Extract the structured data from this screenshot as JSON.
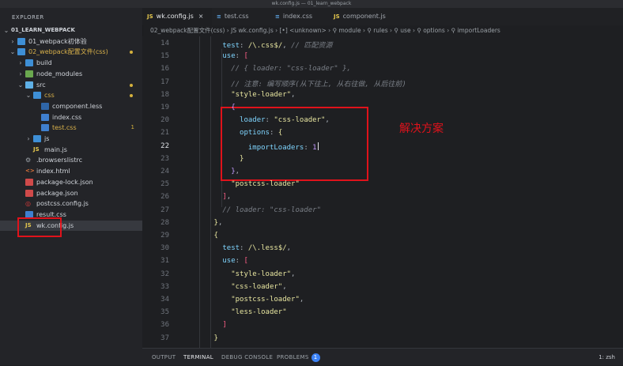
{
  "window": {
    "title": "wk.config.js — 01_learn_webpack"
  },
  "sidebar": {
    "header": "EXPLORER",
    "rows": [
      {
        "chev": "⌄",
        "icon": "",
        "label": "01_LEARN_WEBPACK",
        "indent": 6,
        "bold": true
      },
      {
        "chev": "›",
        "icon": "folder-icon",
        "label": "01_webpack初体验",
        "indent": 14
      },
      {
        "chev": "⌄",
        "icon": "folder-icon",
        "label": "02_webpack配置文件(css)",
        "indent": 14,
        "yellow": true,
        "dot": true
      },
      {
        "chev": "›",
        "icon": "folder-build-icon",
        "label": "build",
        "indent": 24
      },
      {
        "chev": "›",
        "icon": "folder-node-icon",
        "label": "node_modules",
        "indent": 24
      },
      {
        "chev": "⌄",
        "icon": "folder-src-icon",
        "label": "src",
        "indent": 24,
        "dot": true
      },
      {
        "chev": "⌄",
        "icon": "folder-css-icon",
        "label": "css",
        "indent": 34,
        "yellow": true,
        "dot": true
      },
      {
        "chev": "",
        "icon": "less-file-icon",
        "label": "component.less",
        "indent": 44
      },
      {
        "chev": "",
        "icon": "css-file-icon",
        "label": "index.css",
        "indent": 44
      },
      {
        "chev": "",
        "icon": "css-file-icon",
        "label": "test.css",
        "indent": 44,
        "yellow": true,
        "num": "1"
      },
      {
        "chev": "›",
        "icon": "folder-js-icon",
        "label": "js",
        "indent": 34
      },
      {
        "chev": "",
        "icon": "js-file-icon",
        "label": "main.js",
        "indent": 34
      },
      {
        "chev": "",
        "icon": "gear-file-icon",
        "label": ".browserslistrc",
        "indent": 24
      },
      {
        "chev": "",
        "icon": "html-file-icon",
        "label": "index.html",
        "indent": 24
      },
      {
        "chev": "",
        "icon": "json-file-icon",
        "label": "package-lock.json",
        "indent": 24
      },
      {
        "chev": "",
        "icon": "json-file-icon",
        "label": "package.json",
        "indent": 24
      },
      {
        "chev": "",
        "icon": "postcss-file-icon",
        "label": "postcss.config.js",
        "indent": 24
      },
      {
        "chev": "",
        "icon": "css-file-icon",
        "label": "result.css",
        "indent": 24
      },
      {
        "chev": "",
        "icon": "js-file-icon",
        "label": "wk.config.js",
        "indent": 24,
        "selected": true
      }
    ]
  },
  "tabs": [
    {
      "icon": "JS",
      "label": "wk.config.js",
      "active": true,
      "close": "×"
    },
    {
      "icon": "≡",
      "label": "test.css"
    },
    {
      "icon": "≡",
      "label": "index.css"
    },
    {
      "icon": "JS",
      "label": "component.js"
    }
  ],
  "breadcrumb": "02_webpack配置文件(css)  ›  JS wk.config.js  ›  [•] <unknown>  ›  ⚲ module  ›  ⚲ rules  ›  ⚲ use  ›  ⚲ options  ›  ⚲ importLoaders",
  "editor": {
    "lines": [
      {
        "n": "14",
        "html": "        <span class='prop'>test</span><span class='p'>:</span> <span class='s'>/\\.css$/</span><span class='p'>,</span> <span class='c'>// 匹配资源</span>"
      },
      {
        "n": "15",
        "html": "        <span class='prop'>use</span><span class='p'>:</span> <span class='k'>[</span>"
      },
      {
        "n": "16",
        "html": "          <span class='c'>// { loader: \"css-loader\" },</span>"
      },
      {
        "n": "17",
        "html": "          <span class='c'>// 注意: 编写顺序(从下往上, 从右往做, 从后往前)</span>"
      },
      {
        "n": "18",
        "html": "          <span class='s'>\"style-loader\"</span><span class='p'>,</span>"
      },
      {
        "n": "19",
        "html": "          <span class='n'>{</span>"
      },
      {
        "n": "20",
        "html": "            <span class='prop'>loader</span><span class='p'>:</span> <span class='s'>\"css-loader\"</span><span class='p'>,</span>"
      },
      {
        "n": "21",
        "html": "            <span class='prop'>options</span><span class='p'>:</span> <span class='s'>{</span>"
      },
      {
        "n": "22",
        "html": "              <span class='prop'>importLoaders</span><span class='p'>:</span> <span class='n'>1</span><span class='cursor'></span>",
        "cur": true
      },
      {
        "n": "23",
        "html": "            <span class='s'>}</span>"
      },
      {
        "n": "24",
        "html": "          <span class='n'>}</span><span class='p'>,</span>"
      },
      {
        "n": "25",
        "html": "          <span class='s'>\"postcss-loader\"</span>"
      },
      {
        "n": "26",
        "html": "        <span class='k'>]</span><span class='p'>,</span>"
      },
      {
        "n": "27",
        "html": "        <span class='c'>// loader: \"css-loader\"</span>"
      },
      {
        "n": "28",
        "html": "      <span class='s'>}</span><span class='p'>,</span>"
      },
      {
        "n": "29",
        "html": "      <span class='s'>{</span>"
      },
      {
        "n": "30",
        "html": "        <span class='prop'>test</span><span class='p'>:</span> <span class='s'>/\\.less$/</span><span class='p'>,</span>"
      },
      {
        "n": "31",
        "html": "        <span class='prop'>use</span><span class='p'>:</span> <span class='k'>[</span>"
      },
      {
        "n": "32",
        "html": "          <span class='s'>\"style-loader\"</span><span class='p'>,</span>"
      },
      {
        "n": "33",
        "html": "          <span class='s'>\"css-loader\"</span><span class='p'>,</span>"
      },
      {
        "n": "34",
        "html": "          <span class='s'>\"postcss-loader\"</span><span class='p'>,</span>"
      },
      {
        "n": "35",
        "html": "          <span class='s'>\"less-loader\"</span>"
      },
      {
        "n": "36",
        "html": "        <span class='k'>]</span>"
      },
      {
        "n": "37",
        "html": "      <span class='s'>}</span>"
      }
    ],
    "annotation": "解决方案"
  },
  "panel": {
    "tabs": [
      "OUTPUT",
      "TERMINAL",
      "DEBUG CONSOLE",
      "PROBLEMS"
    ],
    "active": "TERMINAL",
    "problems_count": "1",
    "shell": "1: zsh"
  },
  "colors": {
    "annotation_red": "#e0121b",
    "accent_blue": "#3b82f6"
  }
}
